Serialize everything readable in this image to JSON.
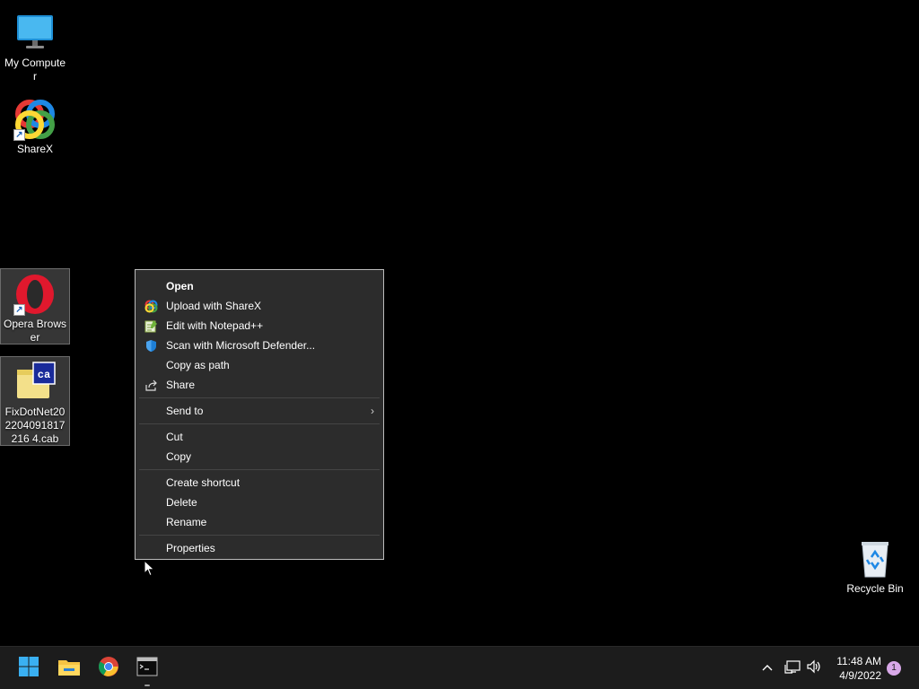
{
  "desktop": {
    "icons": [
      {
        "label": "My Computer",
        "icon": "monitor-icon",
        "selected": false
      },
      {
        "label": "ShareX",
        "icon": "sharex-icon",
        "selected": false
      },
      {
        "label": "Opera Browser",
        "icon": "opera-icon",
        "selected": true
      },
      {
        "label": "FixDotNet202204091817216 4.cab",
        "icon": "cab-file-icon",
        "selected": true
      },
      {
        "label": "Recycle Bin",
        "icon": "recycle-bin-icon",
        "selected": false
      }
    ]
  },
  "context_menu": {
    "open": "Open",
    "upload_sharex": "Upload with ShareX",
    "edit_notepad": "Edit with Notepad++",
    "scan_defender": "Scan with Microsoft Defender...",
    "copy_as_path": "Copy as path",
    "share": "Share",
    "send_to": "Send to",
    "cut": "Cut",
    "copy": "Copy",
    "create_shortcut": "Create shortcut",
    "delete": "Delete",
    "rename": "Rename",
    "properties": "Properties"
  },
  "taskbar": {
    "apps": [
      "start-icon",
      "file-explorer-icon",
      "chrome-icon",
      "terminal-icon"
    ],
    "clock_time": "11:48 AM",
    "clock_date": "4/9/2022",
    "notification_count": "1"
  },
  "colors": {
    "menu_bg": "#2c2c2c",
    "taskbar_bg": "#1c1c1c",
    "accent_blue": "#0078d4"
  }
}
